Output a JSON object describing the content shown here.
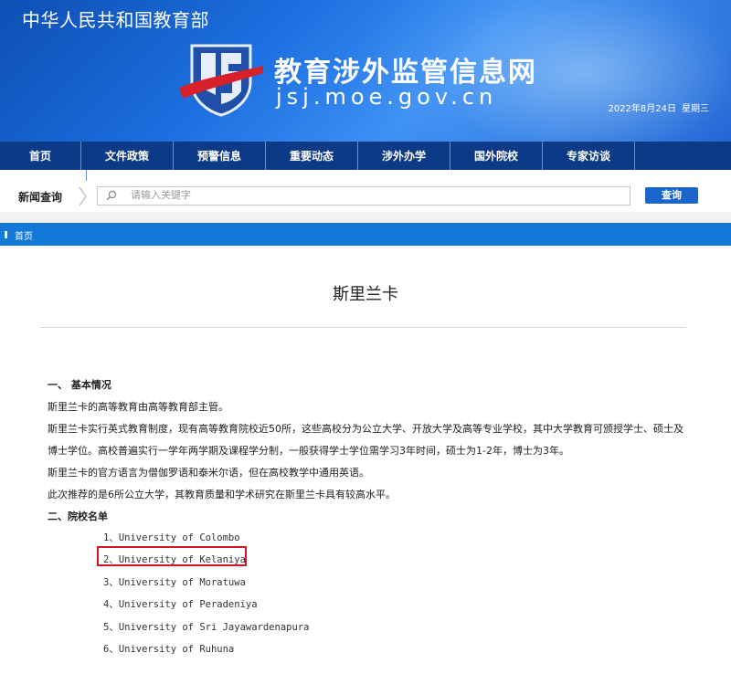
{
  "header": {
    "ministry": "中华人民共和国教育部",
    "site_title": "教育涉外监管信息网",
    "site_domain": "jsj.moe.gov.cn",
    "date": "2022年8月24日",
    "weekday": "星期三"
  },
  "nav": {
    "items": [
      "首页",
      "文件政策",
      "预警信息",
      "重要动态",
      "涉外办学",
      "国外院校",
      "专家访谈"
    ]
  },
  "search": {
    "label": "新闻查询",
    "placeholder": "请输入关键字",
    "button": "查询"
  },
  "breadcrumb": {
    "home": "首页"
  },
  "article": {
    "title": "斯里兰卡",
    "section1_heading": "一、  基本情况",
    "p1": "斯里兰卡的高等教育由高等教育部主管。",
    "p2": "斯里兰卡实行英式教育制度，现有高等教育院校近50所，这些高校分为公立大学、开放大学及高等专业学校，其中大学教育可颁授学士、硕士及博士学位。高校普遍实行一学年两学期及课程学分制，一般获得学士学位需学习3年时间，硕士为1-2年，博士为3年。",
    "p3": "斯里兰卡的官方语言为僧伽罗语和泰米尔语，但在高校教学中通用英语。",
    "p4": "此次推荐的是6所公立大学，其教育质量和学术研究在斯里兰卡具有较高水平。",
    "section2_heading": "二、院校名单",
    "universities": [
      "1、University of Colombo",
      "2、University of Kelaniya",
      "3、University of Moratuwa",
      "4、University of Peradeniya",
      "5、University of Sri Jayawardenapura",
      "6、University of Ruhuna"
    ]
  },
  "colors": {
    "banner": "#1c6fe0",
    "nav": "#0c3a86",
    "breadcrumb": "#1379d8",
    "search_button": "#1a66cc",
    "highlight": "#d01822"
  }
}
